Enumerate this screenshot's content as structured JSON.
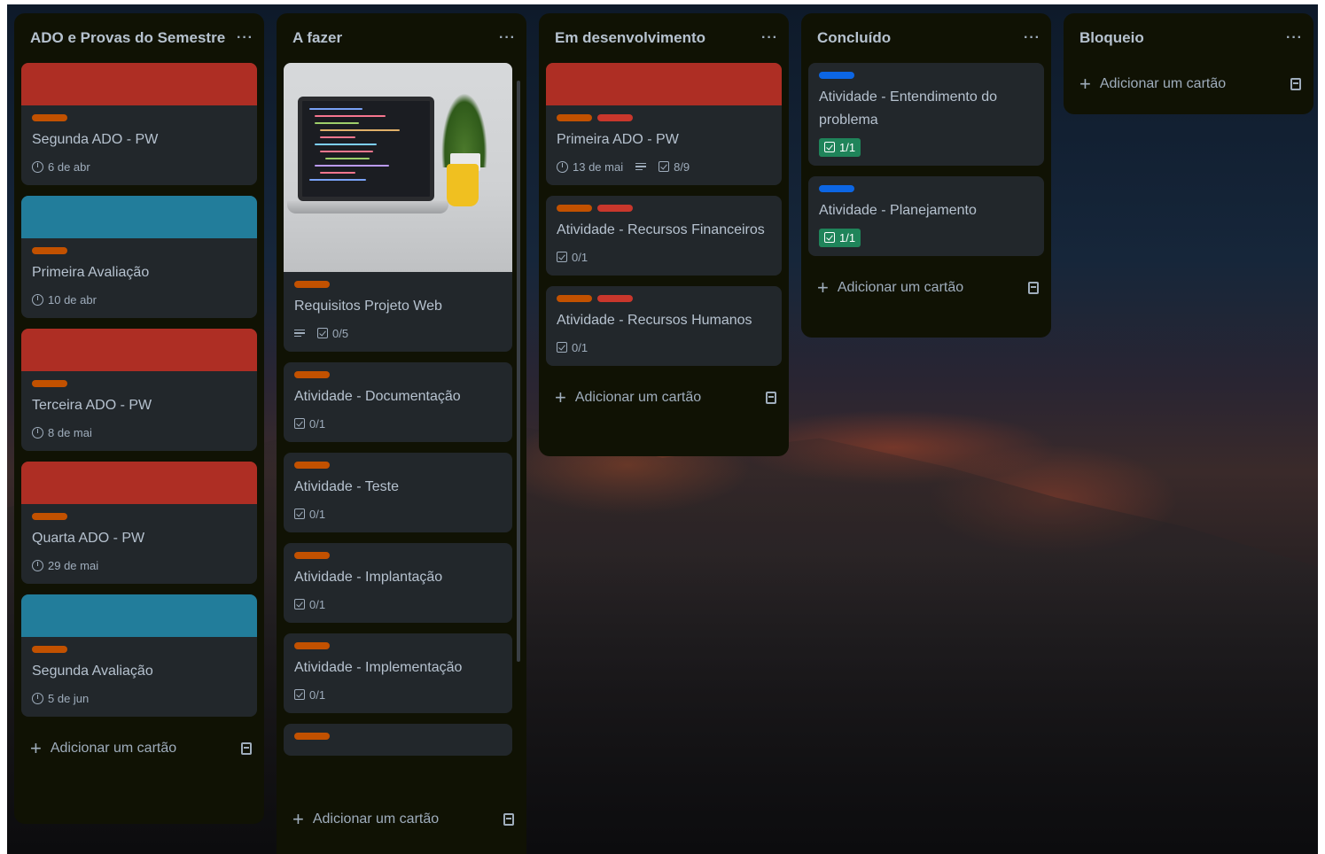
{
  "colors": {
    "list_bg": "#101204",
    "card_bg": "#22272b",
    "red": "#ae2e24",
    "teal": "#227d9b",
    "orange_label": "#c25100",
    "red_label": "#c9372c",
    "blue_label": "#0c66e4",
    "done_green": "#1f845a"
  },
  "lists": [
    {
      "title": "ADO e Provas do Semestre",
      "menu": "···",
      "add_card": "Adicionar um cartão",
      "cards": [
        {
          "cover": "red",
          "labels": [
            "orange"
          ],
          "title": "Segunda ADO - PW",
          "due": "6 de abr"
        },
        {
          "cover": "teal",
          "labels": [
            "orange"
          ],
          "title": "Primeira Avaliação",
          "due": "10 de abr"
        },
        {
          "cover": "red",
          "labels": [
            "orange"
          ],
          "title": "Terceira ADO - PW",
          "due": "8 de mai"
        },
        {
          "cover": "red",
          "labels": [
            "orange"
          ],
          "title": "Quarta ADO - PW",
          "due": "29 de mai"
        },
        {
          "cover": "teal",
          "labels": [
            "orange"
          ],
          "title": "Segunda Avaliação",
          "due": "5 de jun"
        }
      ]
    },
    {
      "title": "A fazer",
      "menu": "···",
      "add_card": "Adicionar um cartão",
      "cards": [
        {
          "cover": "image",
          "labels": [
            "orange"
          ],
          "title": "Requisitos Projeto Web",
          "checklist": "0/5",
          "has_description": true
        },
        {
          "labels": [
            "orange"
          ],
          "title": "Atividade - Documentação",
          "checklist": "0/1"
        },
        {
          "labels": [
            "orange"
          ],
          "title": "Atividade - Teste",
          "checklist": "0/1"
        },
        {
          "labels": [
            "orange"
          ],
          "title": "Atividade - Implantação",
          "checklist": "0/1"
        },
        {
          "labels": [
            "orange"
          ],
          "title": "Atividade - Implementação",
          "checklist": "0/1"
        },
        {
          "labels": [
            "orange"
          ],
          "title": ""
        }
      ]
    },
    {
      "title": "Em desenvolvimento",
      "menu": "···",
      "add_card": "Adicionar um cartão",
      "cards": [
        {
          "cover": "red",
          "labels": [
            "orange",
            "red"
          ],
          "title": "Primeira ADO - PW",
          "due": "13 de mai",
          "has_description": true,
          "checklist": "8/9"
        },
        {
          "labels": [
            "orange",
            "red"
          ],
          "title": "Atividade - Recursos Financeiros",
          "checklist": "0/1"
        },
        {
          "labels": [
            "orange",
            "red"
          ],
          "title": "Atividade - Recursos Humanos",
          "checklist": "0/1"
        }
      ]
    },
    {
      "title": "Concluído",
      "menu": "···",
      "add_card": "Adicionar um cartão",
      "cards": [
        {
          "labels": [
            "blue"
          ],
          "title": "Atividade - Entendimento do problema",
          "checklist_done": "1/1"
        },
        {
          "labels": [
            "blue"
          ],
          "title": "Atividade - Planejamento",
          "checklist_done": "1/1"
        }
      ]
    },
    {
      "title": "Bloqueio",
      "menu": "···",
      "add_card": "Adicionar um cartão",
      "cards": []
    }
  ]
}
